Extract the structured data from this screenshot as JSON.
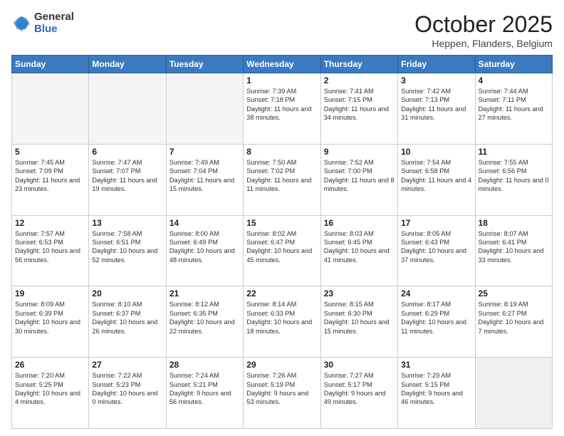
{
  "header": {
    "logo": {
      "general": "General",
      "blue": "Blue"
    },
    "title": "October 2025",
    "location": "Heppen, Flanders, Belgium"
  },
  "days_of_week": [
    "Sunday",
    "Monday",
    "Tuesday",
    "Wednesday",
    "Thursday",
    "Friday",
    "Saturday"
  ],
  "weeks": [
    [
      {
        "day": "",
        "info": "",
        "empty": true
      },
      {
        "day": "",
        "info": "",
        "empty": true
      },
      {
        "day": "",
        "info": "",
        "empty": true
      },
      {
        "day": "1",
        "info": "Sunrise: 7:39 AM\nSunset: 7:18 PM\nDaylight: 11 hours\nand 38 minutes."
      },
      {
        "day": "2",
        "info": "Sunrise: 7:41 AM\nSunset: 7:15 PM\nDaylight: 11 hours\nand 34 minutes."
      },
      {
        "day": "3",
        "info": "Sunrise: 7:42 AM\nSunset: 7:13 PM\nDaylight: 11 hours\nand 31 minutes."
      },
      {
        "day": "4",
        "info": "Sunrise: 7:44 AM\nSunset: 7:11 PM\nDaylight: 11 hours\nand 27 minutes."
      }
    ],
    [
      {
        "day": "5",
        "info": "Sunrise: 7:45 AM\nSunset: 7:09 PM\nDaylight: 11 hours\nand 23 minutes."
      },
      {
        "day": "6",
        "info": "Sunrise: 7:47 AM\nSunset: 7:07 PM\nDaylight: 11 hours\nand 19 minutes."
      },
      {
        "day": "7",
        "info": "Sunrise: 7:49 AM\nSunset: 7:04 PM\nDaylight: 11 hours\nand 15 minutes."
      },
      {
        "day": "8",
        "info": "Sunrise: 7:50 AM\nSunset: 7:02 PM\nDaylight: 11 hours\nand 11 minutes."
      },
      {
        "day": "9",
        "info": "Sunrise: 7:52 AM\nSunset: 7:00 PM\nDaylight: 11 hours\nand 8 minutes."
      },
      {
        "day": "10",
        "info": "Sunrise: 7:54 AM\nSunset: 6:58 PM\nDaylight: 11 hours\nand 4 minutes."
      },
      {
        "day": "11",
        "info": "Sunrise: 7:55 AM\nSunset: 6:56 PM\nDaylight: 11 hours\nand 0 minutes."
      }
    ],
    [
      {
        "day": "12",
        "info": "Sunrise: 7:57 AM\nSunset: 6:53 PM\nDaylight: 10 hours\nand 56 minutes."
      },
      {
        "day": "13",
        "info": "Sunrise: 7:58 AM\nSunset: 6:51 PM\nDaylight: 10 hours\nand 52 minutes."
      },
      {
        "day": "14",
        "info": "Sunrise: 8:00 AM\nSunset: 6:49 PM\nDaylight: 10 hours\nand 48 minutes."
      },
      {
        "day": "15",
        "info": "Sunrise: 8:02 AM\nSunset: 6:47 PM\nDaylight: 10 hours\nand 45 minutes."
      },
      {
        "day": "16",
        "info": "Sunrise: 8:03 AM\nSunset: 6:45 PM\nDaylight: 10 hours\nand 41 minutes."
      },
      {
        "day": "17",
        "info": "Sunrise: 8:05 AM\nSunset: 6:43 PM\nDaylight: 10 hours\nand 37 minutes."
      },
      {
        "day": "18",
        "info": "Sunrise: 8:07 AM\nSunset: 6:41 PM\nDaylight: 10 hours\nand 33 minutes."
      }
    ],
    [
      {
        "day": "19",
        "info": "Sunrise: 8:09 AM\nSunset: 6:39 PM\nDaylight: 10 hours\nand 30 minutes."
      },
      {
        "day": "20",
        "info": "Sunrise: 8:10 AM\nSunset: 6:37 PM\nDaylight: 10 hours\nand 26 minutes."
      },
      {
        "day": "21",
        "info": "Sunrise: 8:12 AM\nSunset: 6:35 PM\nDaylight: 10 hours\nand 22 minutes."
      },
      {
        "day": "22",
        "info": "Sunrise: 8:14 AM\nSunset: 6:33 PM\nDaylight: 10 hours\nand 18 minutes."
      },
      {
        "day": "23",
        "info": "Sunrise: 8:15 AM\nSunset: 6:30 PM\nDaylight: 10 hours\nand 15 minutes."
      },
      {
        "day": "24",
        "info": "Sunrise: 8:17 AM\nSunset: 6:29 PM\nDaylight: 10 hours\nand 11 minutes."
      },
      {
        "day": "25",
        "info": "Sunrise: 8:19 AM\nSunset: 6:27 PM\nDaylight: 10 hours\nand 7 minutes."
      }
    ],
    [
      {
        "day": "26",
        "info": "Sunrise: 7:20 AM\nSunset: 5:25 PM\nDaylight: 10 hours\nand 4 minutes."
      },
      {
        "day": "27",
        "info": "Sunrise: 7:22 AM\nSunset: 5:23 PM\nDaylight: 10 hours\nand 0 minutes."
      },
      {
        "day": "28",
        "info": "Sunrise: 7:24 AM\nSunset: 5:21 PM\nDaylight: 9 hours\nand 56 minutes."
      },
      {
        "day": "29",
        "info": "Sunrise: 7:26 AM\nSunset: 5:19 PM\nDaylight: 9 hours\nand 53 minutes."
      },
      {
        "day": "30",
        "info": "Sunrise: 7:27 AM\nSunset: 5:17 PM\nDaylight: 9 hours\nand 49 minutes."
      },
      {
        "day": "31",
        "info": "Sunrise: 7:29 AM\nSunset: 5:15 PM\nDaylight: 9 hours\nand 46 minutes."
      },
      {
        "day": "",
        "info": "",
        "empty": true,
        "shaded": true
      }
    ]
  ]
}
